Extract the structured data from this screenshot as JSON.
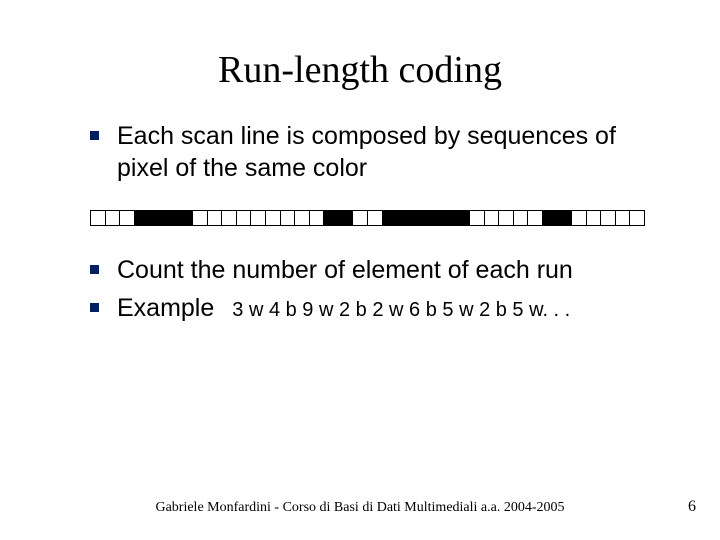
{
  "slide": {
    "title": "Run-length coding",
    "bullets": [
      "Each scan line is composed by sequences of pixel of the same color",
      "Count the number of element of each run"
    ],
    "example_label": "Example",
    "example_code": "3 w 4 b 9 w 2 b 2 w 6 b 5 w 2 b 5 w. . .",
    "footer": "Gabriele Monfardini - Corso di Basi di Dati Multimediali  a.a. 2004-2005",
    "page_number": "6"
  },
  "scanline_runs": [
    {
      "color": "w",
      "len": 3
    },
    {
      "color": "b",
      "len": 4
    },
    {
      "color": "w",
      "len": 9
    },
    {
      "color": "b",
      "len": 2
    },
    {
      "color": "w",
      "len": 2
    },
    {
      "color": "b",
      "len": 6
    },
    {
      "color": "w",
      "len": 5
    },
    {
      "color": "b",
      "len": 2
    },
    {
      "color": "w",
      "len": 5
    }
  ]
}
